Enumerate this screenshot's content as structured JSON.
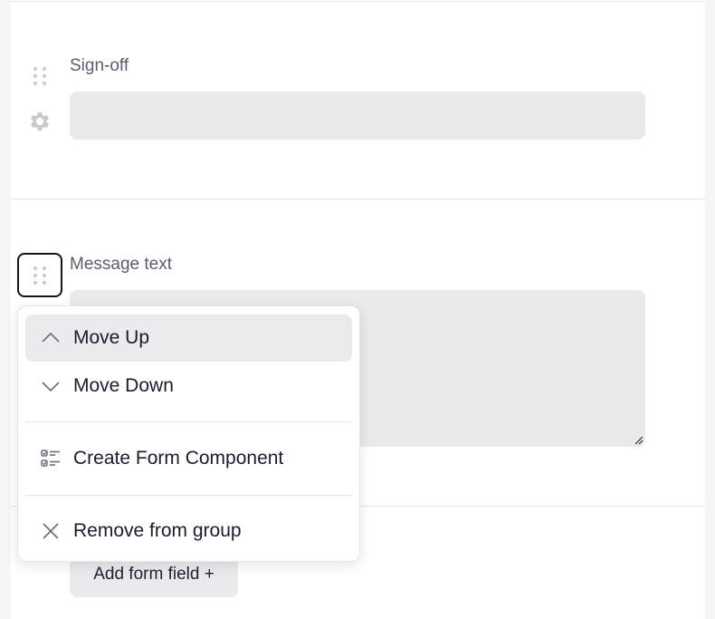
{
  "fields": [
    {
      "label": "Sign-off",
      "type": "text",
      "value": ""
    },
    {
      "label": "Message text",
      "type": "textarea",
      "value": ""
    }
  ],
  "add_field_button": {
    "label": "Add form field +"
  },
  "context_menu": {
    "items": [
      {
        "label": "Move Up",
        "icon": "chevron-up-icon",
        "active": true
      },
      {
        "label": "Move Down",
        "icon": "chevron-down-icon",
        "active": false
      },
      {
        "label": "Create Form Component",
        "icon": "checklist-icon",
        "active": false
      },
      {
        "label": "Remove from group",
        "icon": "close-icon",
        "active": false
      }
    ]
  },
  "colors": {
    "input_bg": "#e9eaec",
    "label": "#5b5d6e",
    "text": "#1a1c2e",
    "focus_ring": "#111322",
    "icon": "#c9cacf"
  }
}
